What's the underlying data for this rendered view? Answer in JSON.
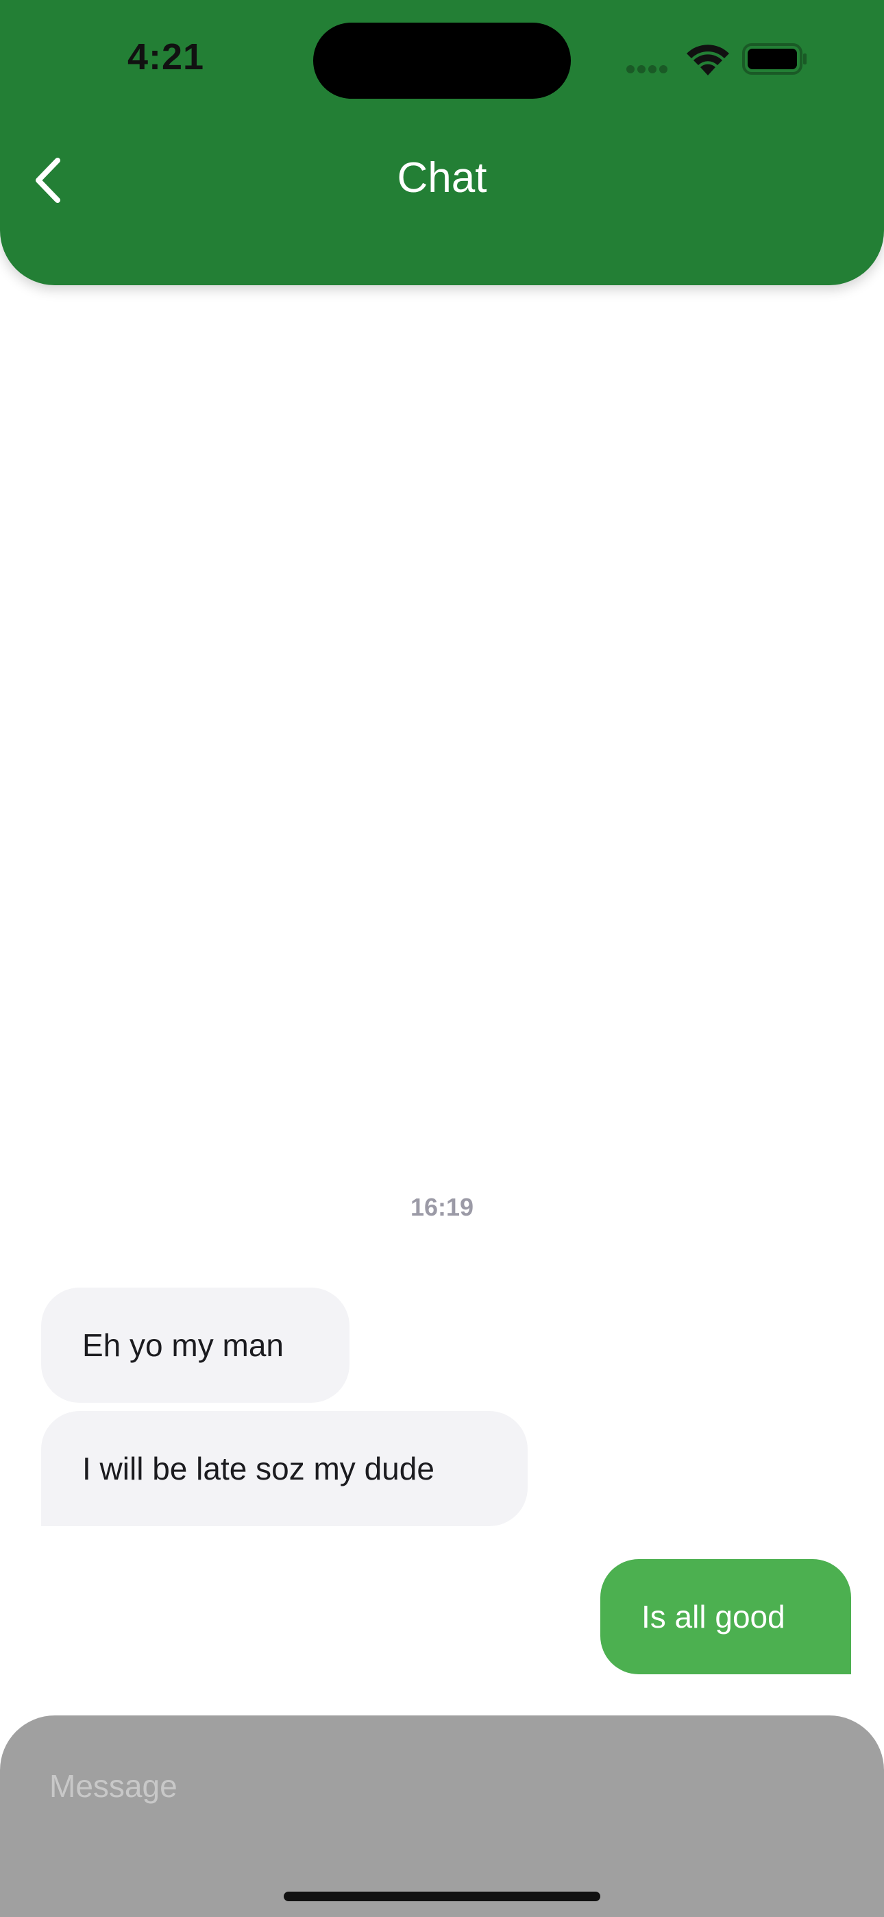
{
  "status_bar": {
    "time": "4:21"
  },
  "header": {
    "title": "Chat",
    "back_icon": "chevron-left-icon",
    "background_color": "#237f35"
  },
  "conversation": {
    "timestamp": "16:19",
    "messages": [
      {
        "direction": "received",
        "text": "Eh yo my man"
      },
      {
        "direction": "received",
        "text": "I will be late soz my dude"
      },
      {
        "direction": "sent",
        "text": "Is all good"
      }
    ],
    "received_bubble_color": "#f3f3f6",
    "sent_bubble_color": "#4cb050"
  },
  "composer": {
    "placeholder": "Message",
    "value": "",
    "background_color": "#a0a0a0"
  }
}
